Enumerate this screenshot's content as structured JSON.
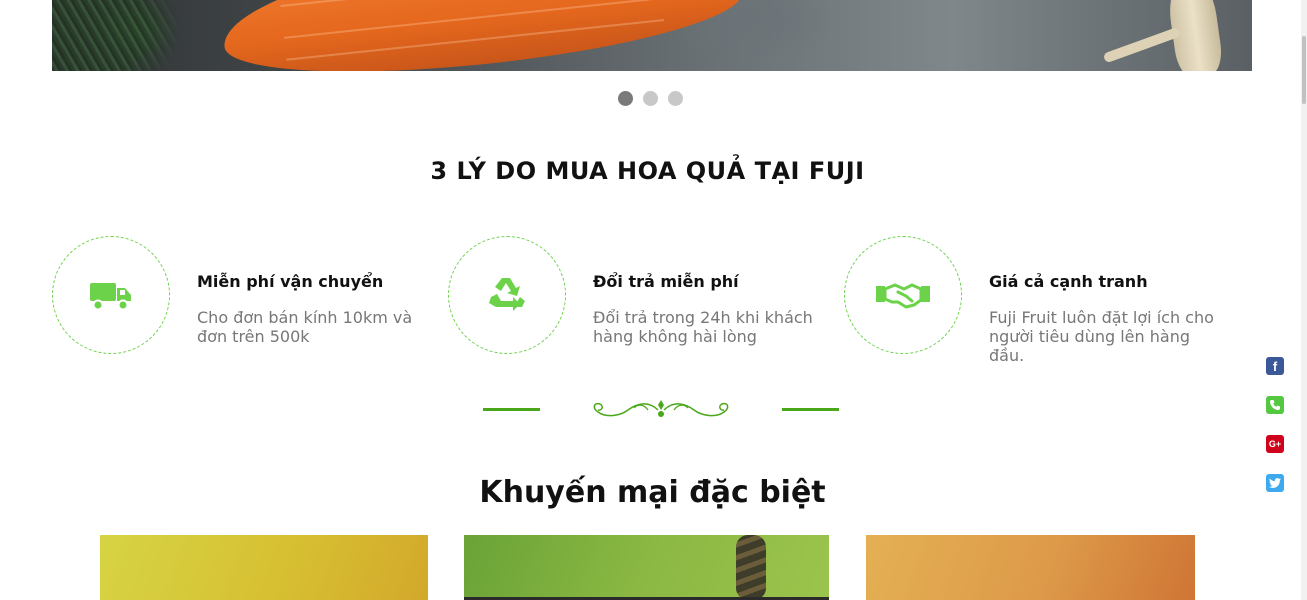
{
  "hero": {
    "image": "vegetables-banner",
    "slide_count": 3,
    "active_slide": 1
  },
  "reasons": {
    "title": "3 LÝ DO MUA HOA QUẢ TẠI FUJI",
    "items": [
      {
        "icon": "truck-icon",
        "title": "Miễn phí vận chuyển",
        "desc": "Cho đơn bán kính 10km và đơn trên 500k"
      },
      {
        "icon": "recycle-icon",
        "title": "Đổi trả miễn phí",
        "desc": "Đổi trả trong 24h khi khách hàng không hài lòng"
      },
      {
        "icon": "handshake-icon",
        "title": "Giá cả cạnh tranh",
        "desc": "Fuji Fruit luôn đặt lợi ích cho người tiêu dùng lên hàng đầu."
      }
    ]
  },
  "promo": {
    "title": "Khuyến mại đặc biệt"
  },
  "social": [
    {
      "icon": "facebook-icon",
      "glyph": "f"
    },
    {
      "icon": "phone-icon",
      "glyph": ""
    },
    {
      "icon": "google-plus-icon",
      "glyph": "G+"
    },
    {
      "icon": "twitter-icon",
      "glyph": ""
    }
  ],
  "colors": {
    "accent": "#6cd24a",
    "divider": "#4aa71a",
    "dot_active": "#7a7a7a",
    "dot": "#c8c8c8"
  }
}
